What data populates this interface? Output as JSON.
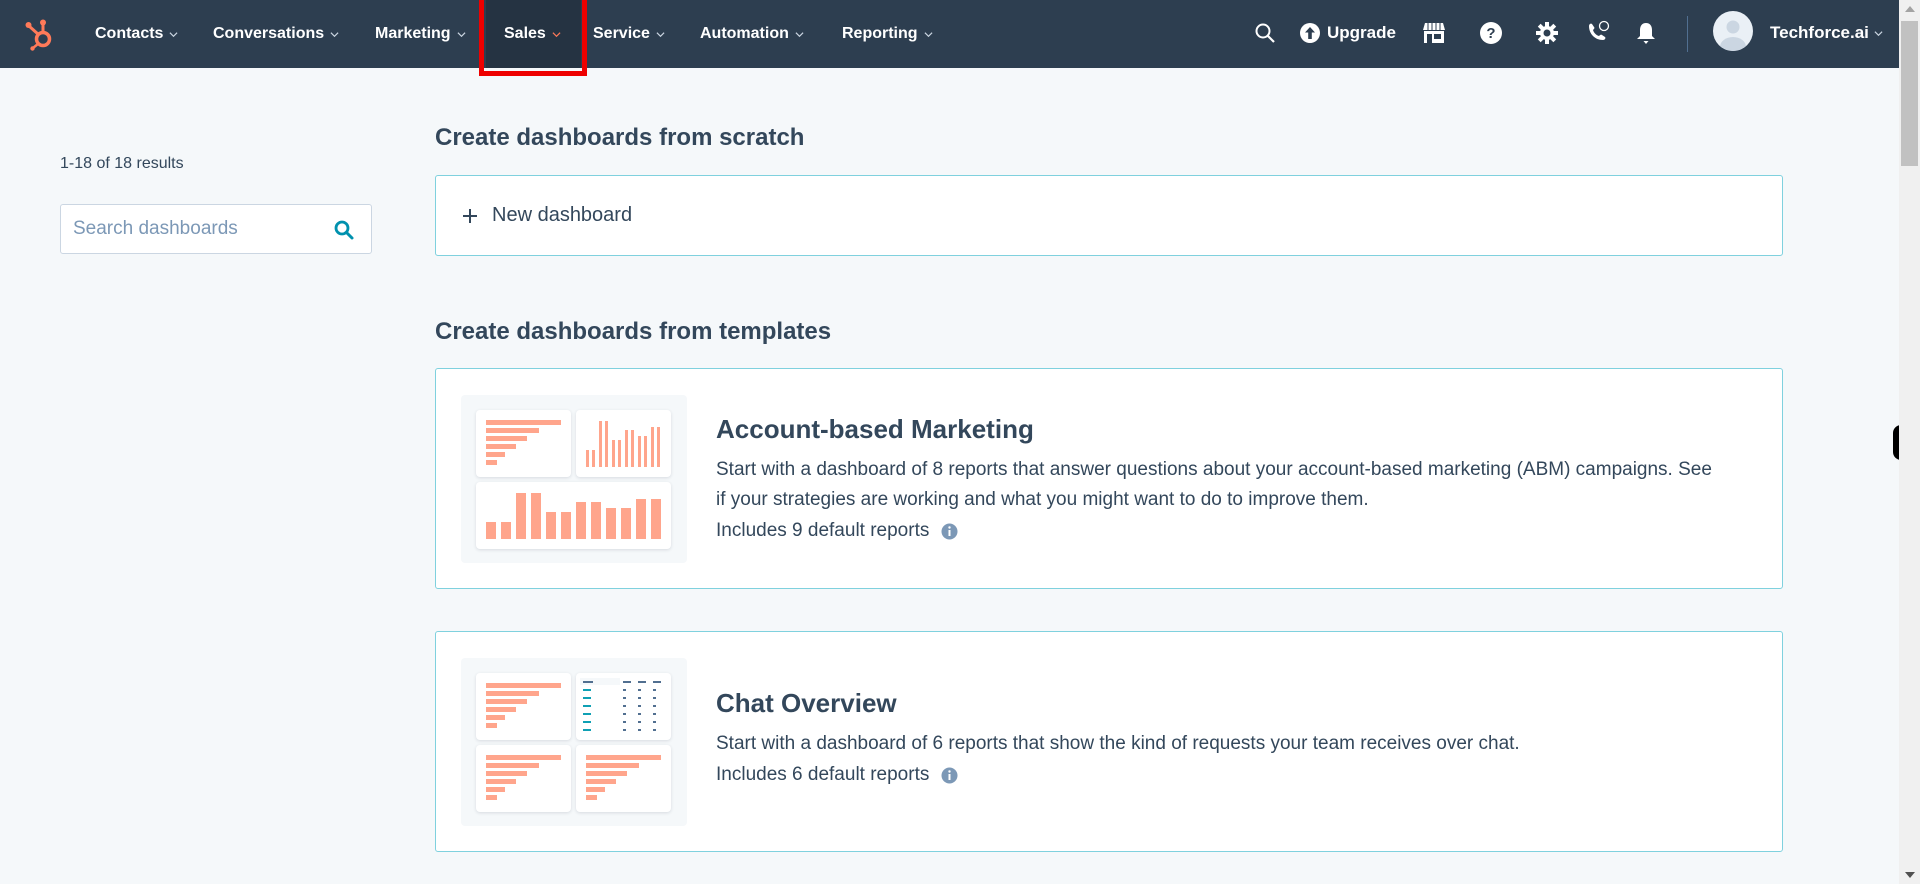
{
  "nav": {
    "items": [
      {
        "label": "Contacts",
        "active": false
      },
      {
        "label": "Conversations",
        "active": false
      },
      {
        "label": "Marketing",
        "active": false
      },
      {
        "label": "Sales",
        "active": true
      },
      {
        "label": "Service",
        "active": false
      },
      {
        "label": "Automation",
        "active": false
      },
      {
        "label": "Reporting",
        "active": false
      }
    ],
    "upgrade_label": "Upgrade",
    "account_name": "Techforce.ai",
    "icons": [
      "search-icon",
      "upgrade-icon",
      "marketplace-icon",
      "help-icon",
      "settings-icon",
      "calling-icon",
      "notifications-icon"
    ],
    "accent_color": "#ff7a59"
  },
  "sidebar": {
    "results_text": "1-18 of 18 results",
    "search_placeholder": "Search dashboards",
    "search_value": ""
  },
  "main": {
    "scratch_heading": "Create dashboards from scratch",
    "new_dashboard_label": "New dashboard",
    "templates_heading": "Create dashboards from templates",
    "templates": [
      {
        "title": "Account-based Marketing",
        "description": "Start with a dashboard of 8 reports that answer questions about your account-based marketing (ABM) campaigns. See if your strategies are working and what you might want to do to improve them.",
        "includes": "Includes 9 default reports"
      },
      {
        "title": "Chat Overview",
        "description": "Start with a dashboard of 6 reports that show the kind of requests your team receives over chat.",
        "includes": "Includes 6 default reports"
      }
    ]
  },
  "colors": {
    "nav_bg": "#2d3e50",
    "card_border": "#7fd1de",
    "preview_bar": "#ffa58c",
    "link": "#0091ae"
  }
}
